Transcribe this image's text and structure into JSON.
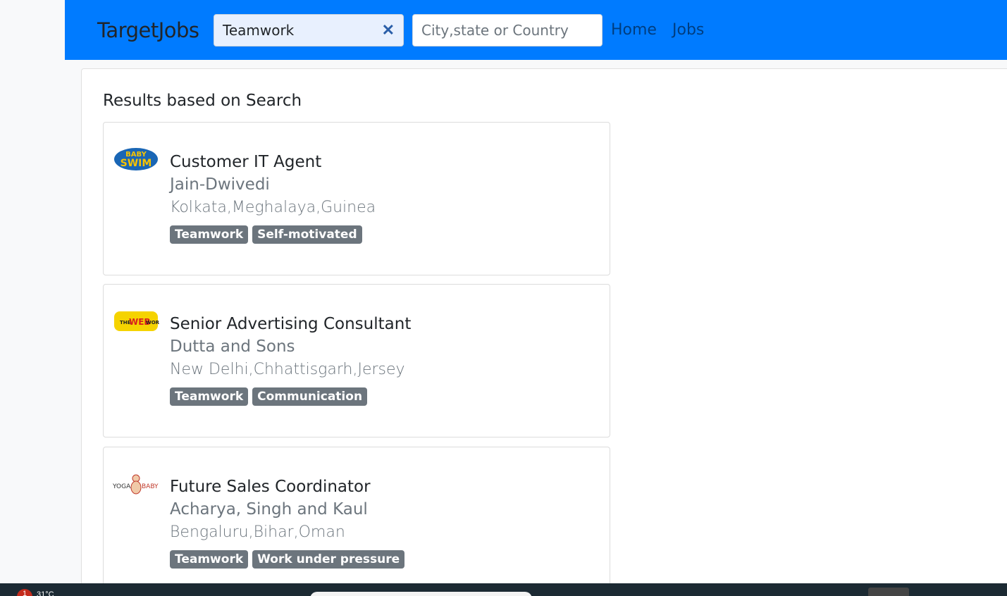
{
  "nav": {
    "brand": "TargetJobs",
    "search_value": "Teamwork",
    "location_placeholder": "City,state or Country",
    "links": [
      "Home",
      "Jobs"
    ]
  },
  "results": {
    "heading": "Results based on Search",
    "jobs": [
      {
        "title": "Customer IT Agent",
        "company": "Jain-Dwivedi",
        "location": "Kolkata,Meghalaya,Guinea",
        "tags": [
          "Teamwork",
          "Self-motivated"
        ],
        "logo_text": [
          "BABY",
          "SWIM"
        ]
      },
      {
        "title": "Senior Advertising Consultant",
        "company": "Dutta and Sons",
        "location": "New Delhi,Chhattisgarh,Jersey",
        "tags": [
          "Teamwork",
          "Communication"
        ],
        "logo_text": [
          "THE",
          "WEB",
          "WORKS"
        ]
      },
      {
        "title": "Future Sales Coordinator",
        "company": "Acharya, Singh and Kaul",
        "location": "Bengaluru,Bihar,Oman",
        "tags": [
          "Teamwork",
          "Work under pressure"
        ],
        "logo_text": [
          "YOGA",
          "BABY"
        ]
      }
    ]
  },
  "taskbar": {
    "badge": "1",
    "temp": "31°C"
  },
  "colors": {
    "navbar": "#007bff",
    "tag_bg": "#6c757d",
    "clear_icon": "#2a5ea8"
  }
}
